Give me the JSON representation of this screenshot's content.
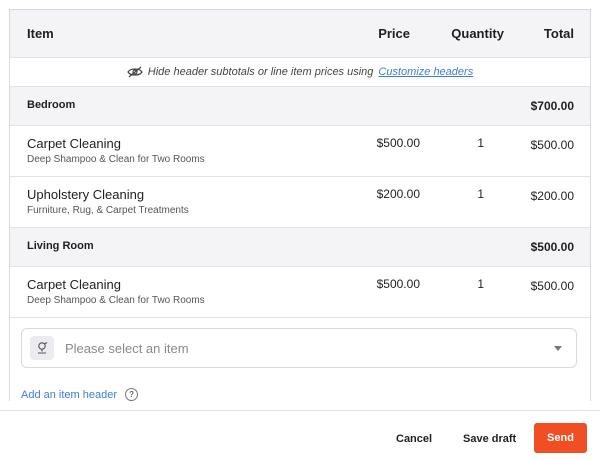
{
  "table": {
    "headers": {
      "item": "Item",
      "price": "Price",
      "quantity": "Quantity",
      "total": "Total"
    },
    "hint": {
      "text": "Hide header subtotals or line item prices using",
      "link": "Customize headers"
    },
    "sections": [
      {
        "name": "Bedroom",
        "total": "$700.00",
        "items": [
          {
            "name": "Carpet Cleaning",
            "description": "Deep Shampoo & Clean for Two Rooms",
            "price": "$500.00",
            "quantity": "1",
            "total": "$500.00"
          },
          {
            "name": "Upholstery Cleaning",
            "description": "Furniture, Rug, & Carpet Treatments",
            "price": "$200.00",
            "quantity": "1",
            "total": "$200.00"
          }
        ]
      },
      {
        "name": "Living Room",
        "total": "$500.00",
        "items": [
          {
            "name": "Carpet Cleaning",
            "description": "Deep Shampoo & Clean for Two Rooms",
            "price": "$500.00",
            "quantity": "1",
            "total": "$500.00"
          }
        ]
      }
    ]
  },
  "select": {
    "placeholder": "Please select an item",
    "icon": "item-catalog-icon"
  },
  "add_header": {
    "label": "Add an item header",
    "icon": "help-icon"
  },
  "footer": {
    "cancel": "Cancel",
    "save_draft": "Save draft",
    "send": "Send"
  },
  "colors": {
    "accent": "#f04e23",
    "link": "#3b7fd4",
    "header_bg": "#f4f4f6"
  }
}
